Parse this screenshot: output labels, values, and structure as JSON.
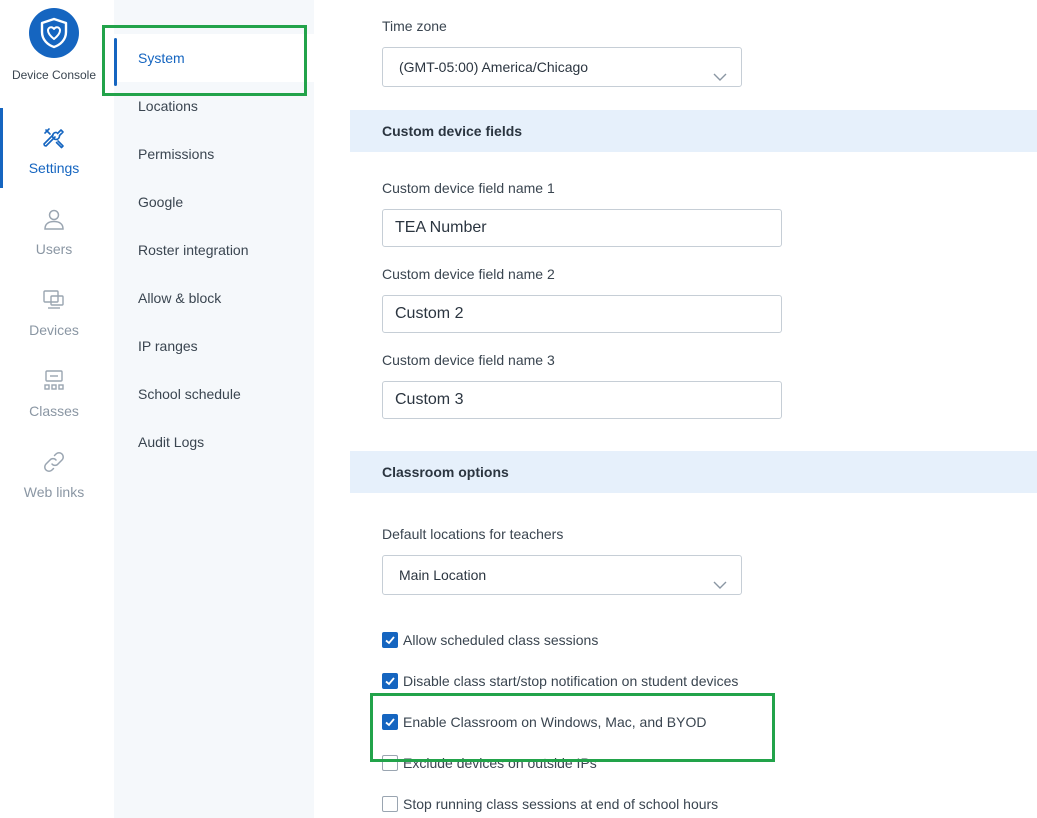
{
  "app": {
    "logo_text": "Device Console"
  },
  "rail": [
    {
      "label": "Settings",
      "icon": "tools-icon",
      "active": true
    },
    {
      "label": "Users",
      "icon": "user-icon",
      "active": false
    },
    {
      "label": "Devices",
      "icon": "devices-icon",
      "active": false
    },
    {
      "label": "Classes",
      "icon": "classes-icon",
      "active": false
    },
    {
      "label": "Web links",
      "icon": "link-icon",
      "active": false
    }
  ],
  "subnav": [
    {
      "label": "System",
      "active": true
    },
    {
      "label": "Locations"
    },
    {
      "label": "Permissions"
    },
    {
      "label": "Google"
    },
    {
      "label": "Roster integration"
    },
    {
      "label": "Allow & block"
    },
    {
      "label": "IP ranges"
    },
    {
      "label": "School schedule"
    },
    {
      "label": "Audit Logs"
    }
  ],
  "timezone": {
    "label": "Time zone",
    "value": "(GMT-05:00) America/Chicago"
  },
  "custom_fields": {
    "title": "Custom device fields",
    "fields": [
      {
        "label": "Custom device field name 1",
        "value": "TEA Number"
      },
      {
        "label": "Custom device field name 2",
        "value": "Custom 2"
      },
      {
        "label": "Custom device field name 3",
        "value": "Custom 3"
      }
    ]
  },
  "classroom": {
    "title": "Classroom options",
    "default_locations": {
      "label": "Default locations for teachers",
      "value": "Main Location"
    },
    "options": [
      {
        "label": "Allow scheduled class sessions",
        "checked": true
      },
      {
        "label": "Disable class start/stop notification on student devices",
        "checked": true
      },
      {
        "label": "Enable Classroom on Windows, Mac, and BYOD",
        "checked": true
      },
      {
        "label": "Exclude devices on outside IPs",
        "checked": false
      },
      {
        "label": "Stop running class sessions at end of school hours",
        "checked": false
      }
    ]
  },
  "colors": {
    "accent": "#1565c0",
    "highlight": "#22a34a",
    "section_bg": "#e6f0fb",
    "subnav_bg": "#f5f8fb"
  }
}
